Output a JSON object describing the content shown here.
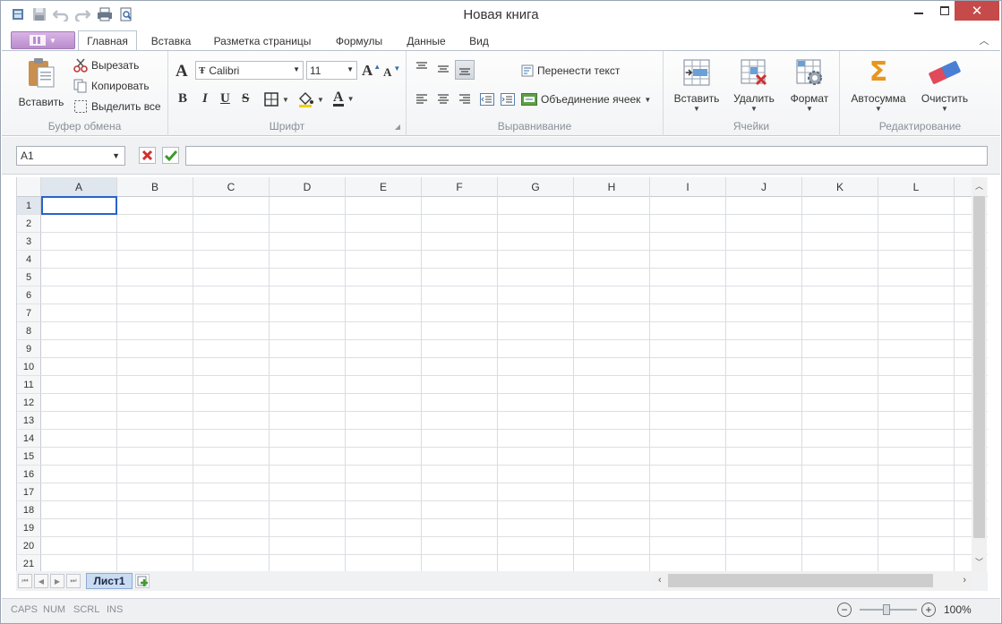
{
  "window": {
    "title": "Новая книга"
  },
  "tabs": [
    "Главная",
    "Вставка",
    "Разметка страницы",
    "Формулы",
    "Данные",
    "Вид"
  ],
  "ribbon": {
    "clipboard": {
      "label": "Буфер обмена",
      "paste": "Вставить",
      "cut": "Вырезать",
      "copy": "Копировать",
      "select_all": "Выделить все"
    },
    "font": {
      "label": "Шрифт",
      "family": "Calibri",
      "size": "11"
    },
    "alignment": {
      "label": "Выравнивание",
      "wrap": "Перенести текст",
      "merge": "Объединение ячеек"
    },
    "cells": {
      "label": "Ячейки",
      "insert": "Вставить",
      "delete": "Удалить",
      "format": "Формат"
    },
    "editing": {
      "label": "Редактирование",
      "autosum": "Автосумма",
      "clear": "Очистить"
    }
  },
  "formula": {
    "name_box": "A1",
    "value": ""
  },
  "grid": {
    "columns": [
      "A",
      "B",
      "C",
      "D",
      "E",
      "F",
      "G",
      "H",
      "I",
      "J",
      "K",
      "L"
    ],
    "rows": [
      "1",
      "2",
      "3",
      "4",
      "5",
      "6",
      "7",
      "8",
      "9",
      "10",
      "11",
      "12",
      "13",
      "14",
      "15",
      "16",
      "17",
      "18",
      "19",
      "20",
      "21"
    ],
    "selected_cell": "A1"
  },
  "sheets": {
    "active": "Лист1"
  },
  "status": {
    "caps": "CAPS",
    "num": "NUM",
    "scrl": "SCRL",
    "ins": "INS",
    "zoom": "100%"
  },
  "colors": {
    "accent": "#2a63c8",
    "close": "#c74a4a",
    "sheet_tab": "#c9dcf3"
  }
}
